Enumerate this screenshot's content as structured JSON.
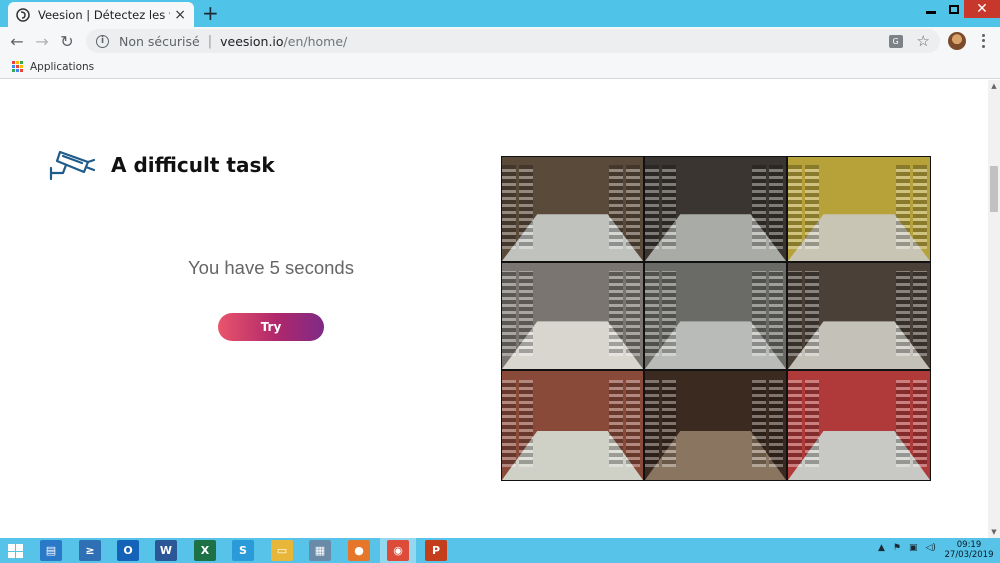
{
  "browser": {
    "tab_title": "Veesion | Détectez les vols autom",
    "new_tab": "+",
    "tab_close": "×",
    "close_window": "✕",
    "security_label": "Non sécurisé",
    "url_separator": "|",
    "url_host": "veesion.io",
    "url_path": "/en/home/",
    "back": "←",
    "forward": "→",
    "reload": "↻",
    "bookmark_star": "☆",
    "translate_glyph": "G",
    "info_glyph": "i"
  },
  "bookmarks": {
    "apps_label": "Applications"
  },
  "page": {
    "heading": "A difficult task",
    "subtitle": "You have 5 seconds",
    "try_button": "Try",
    "brand_color": "#1f5b8a"
  },
  "cctv": {
    "cells": [
      {
        "floor": "#bfc2bd",
        "shelf": "#5a4a3a"
      },
      {
        "floor": "#a9aba6",
        "shelf": "#3a3530"
      },
      {
        "floor": "#c9c5b5",
        "shelf": "#b7a23a"
      },
      {
        "floor": "#d8d6cf",
        "shelf": "#7a7570"
      },
      {
        "floor": "#b9bbb8",
        "shelf": "#6a6a66"
      },
      {
        "floor": "#c4c2b8",
        "shelf": "#4a4038"
      },
      {
        "floor": "#cfd0c6",
        "shelf": "#8a4a3a"
      },
      {
        "floor": "#8a7560",
        "shelf": "#3a2a20"
      },
      {
        "floor": "#c8c9c4",
        "shelf": "#b03a3a"
      }
    ]
  },
  "taskbar": {
    "apps": [
      {
        "icon": "explorer-pc-icon",
        "glyph": "▤",
        "color": "#2a78c8"
      },
      {
        "icon": "powershell-icon",
        "glyph": "≥",
        "color": "#2f6fb3"
      },
      {
        "icon": "outlook-icon",
        "glyph": "O",
        "color": "#1463b8"
      },
      {
        "icon": "word-icon",
        "glyph": "W",
        "color": "#2b5797"
      },
      {
        "icon": "excel-icon",
        "glyph": "X",
        "color": "#1e7145"
      },
      {
        "icon": "lync-icon",
        "glyph": "S",
        "color": "#2a9ad8"
      },
      {
        "icon": "file-explorer-icon",
        "glyph": "▭",
        "color": "#e8b73a"
      },
      {
        "icon": "calculator-icon",
        "glyph": "▦",
        "color": "#6a8ba8"
      },
      {
        "icon": "firefox-icon",
        "glyph": "●",
        "color": "#e5762a"
      },
      {
        "icon": "chrome-icon",
        "glyph": "◉",
        "color": "#dd4b39"
      },
      {
        "icon": "powerpoint-icon",
        "glyph": "P",
        "color": "#c43e1c"
      }
    ],
    "time": "09:19",
    "date": "27/03/2019"
  }
}
